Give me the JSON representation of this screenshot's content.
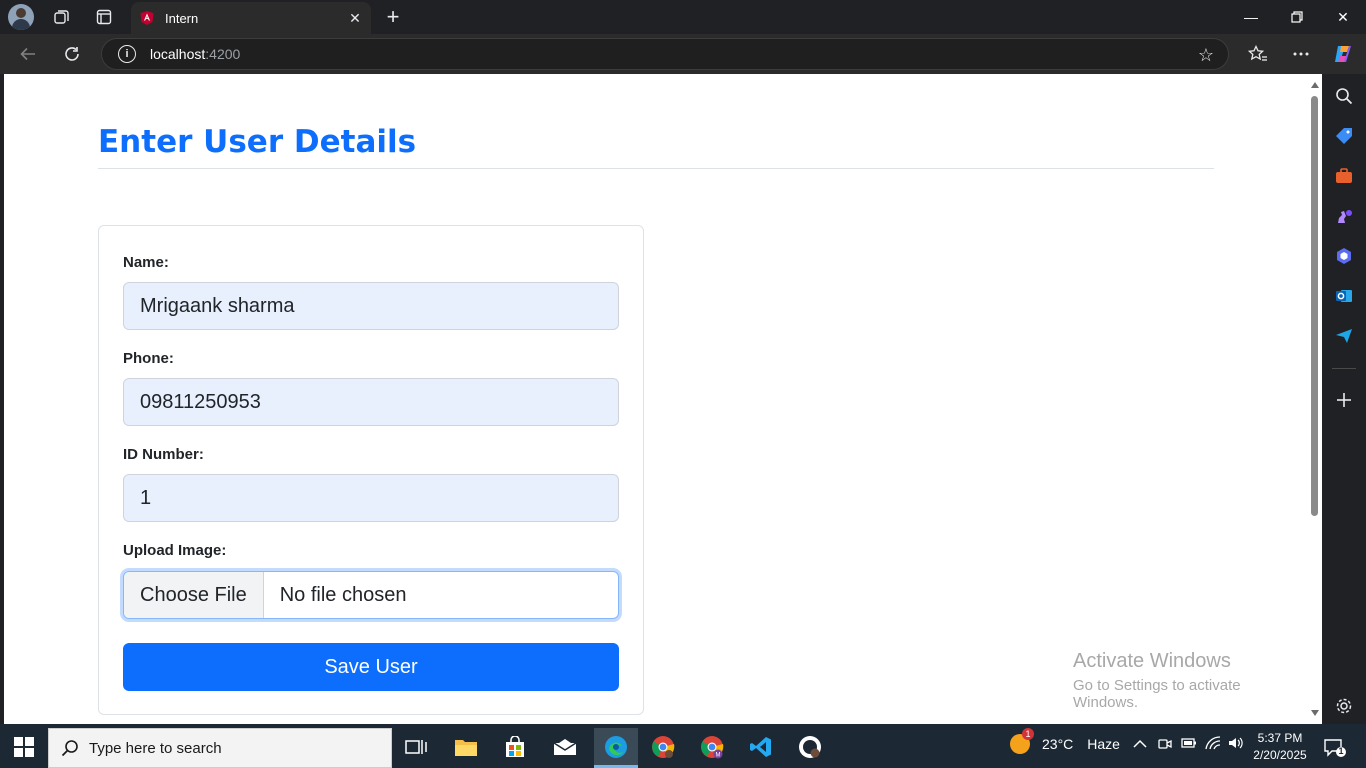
{
  "browser": {
    "tab_title": "Intern",
    "url_host": "localhost",
    "url_port": ":4200"
  },
  "page": {
    "title": "Enter User Details",
    "form": {
      "name_label": "Name:",
      "name_value": "Mrigaank sharma",
      "phone_label": "Phone:",
      "phone_value": "09811250953",
      "id_label": "ID Number:",
      "id_value": "1",
      "image_label": "Upload Image:",
      "choose_file": "Choose File",
      "no_file": "No file chosen",
      "save_label": "Save User"
    },
    "accent_color": "#0d6efd"
  },
  "watermark": {
    "line1": "Activate Windows",
    "line2": "Go to Settings to activate Windows."
  },
  "taskbar": {
    "search_placeholder": "Type here to search",
    "temperature": "23°C",
    "condition": "Haze",
    "weather_badge": "1",
    "time": "5:37 PM",
    "date": "2/20/2025",
    "notification_count": "1"
  }
}
